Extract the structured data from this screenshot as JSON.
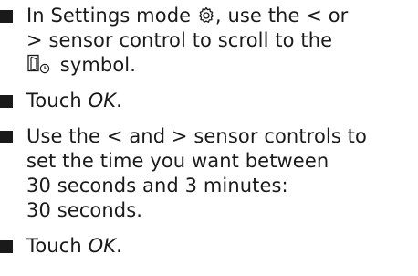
{
  "steps": [
    {
      "text_a": "In Settings mode ",
      "icon": "gear-icon",
      "text_b": ", use the < or",
      "text_c": "> sensor control to scroll to the",
      "icon2": "door-timer-icon",
      "text_d": " symbol."
    },
    {
      "text_a": "Touch ",
      "emph": "OK",
      "text_b": "."
    },
    {
      "line1": "Use the < and > sensor controls to",
      "line2": "set the time you want between",
      "line3": "30 seconds and 3 minutes:",
      "line4": "30 seconds."
    },
    {
      "text_a": "Touch ",
      "emph": "OK",
      "text_b": "."
    }
  ]
}
